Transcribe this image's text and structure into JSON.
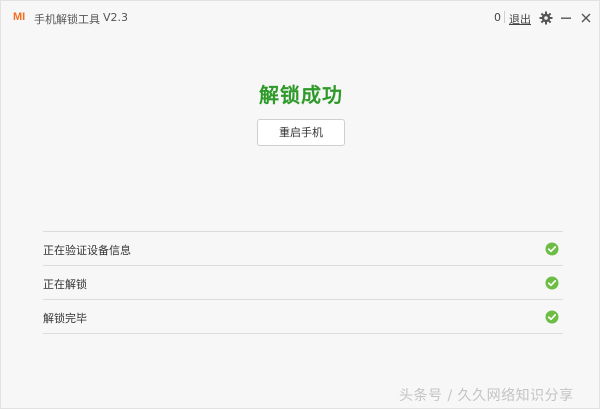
{
  "titlebar": {
    "logo": "MI",
    "app_title": "手机解锁工具",
    "version": "V2.3",
    "user_id": "0",
    "logout": "退出"
  },
  "main": {
    "headline": "解锁成功",
    "restart_button": "重启手机",
    "steps": [
      {
        "label": "正在验证设备信息",
        "status": "done"
      },
      {
        "label": "正在解锁",
        "status": "done"
      },
      {
        "label": "解锁完毕",
        "status": "done"
      }
    ]
  },
  "watermark": "头条号 / 久久网络知识分享",
  "colors": {
    "accent": "#f26e21",
    "success": "#2e9a29",
    "check": "#6dbd45"
  },
  "icons": [
    "settings-gear-icon",
    "minimize-icon",
    "close-icon",
    "checkmark-icon"
  ]
}
